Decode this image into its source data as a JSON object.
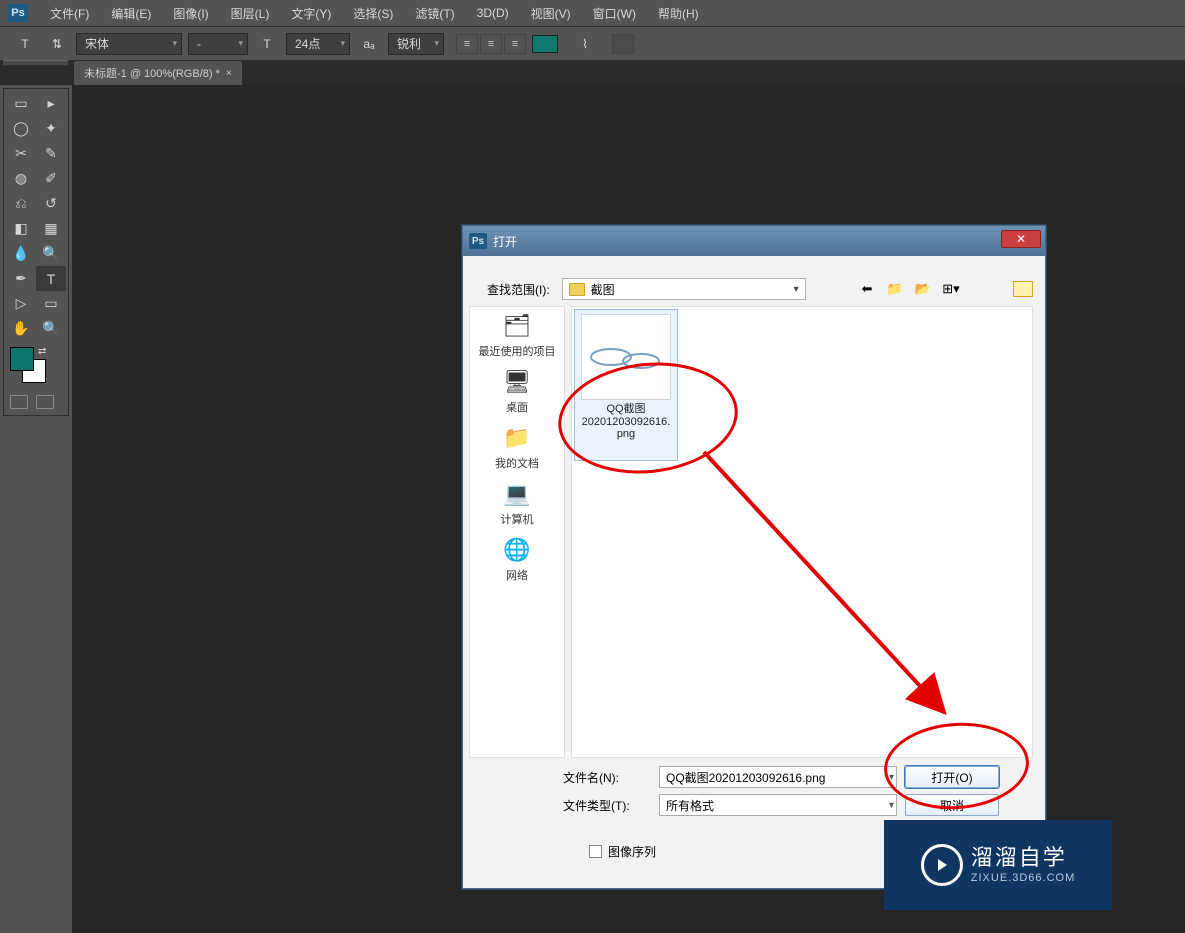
{
  "menu": {
    "items": [
      "文件(F)",
      "编辑(E)",
      "图像(I)",
      "图层(L)",
      "文字(Y)",
      "选择(S)",
      "滤镜(T)",
      "3D(D)",
      "视图(V)",
      "窗口(W)",
      "帮助(H)"
    ]
  },
  "options": {
    "font_family": "宋体",
    "font_style": "-",
    "font_size": "24点",
    "anti_alias": "锐利",
    "color": "#0d7a6a"
  },
  "tab": {
    "label": "未标题-1 @ 100%(RGB/8) *"
  },
  "dialog": {
    "title": "打开",
    "lookup_label": "查找范围(I):",
    "lookup_value": "截图",
    "places": [
      "最近使用的项目",
      "桌面",
      "我的文档",
      "计算机",
      "网络"
    ],
    "file": {
      "line1": "QQ截图",
      "line2": "20201203092616.",
      "line3": "png"
    },
    "filename_label": "文件名(N):",
    "filename_value": "QQ截图20201203092616.png",
    "filetype_label": "文件类型(T):",
    "filetype_value": "所有格式",
    "open_btn": "打开(O)",
    "cancel_btn": "取消",
    "image_seq": "图像序列"
  },
  "watermark": {
    "big": "溜溜自学",
    "small": "ZIXUE.3D66.COM"
  }
}
